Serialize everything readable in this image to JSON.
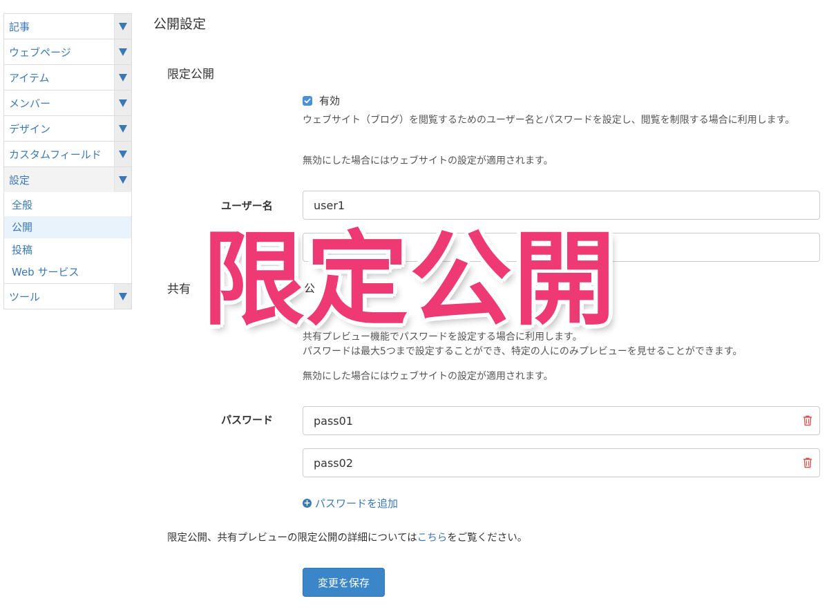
{
  "sidebar": {
    "items": [
      {
        "label": "記事"
      },
      {
        "label": "ウェブページ"
      },
      {
        "label": "アイテム"
      },
      {
        "label": "メンバー"
      },
      {
        "label": "デザイン"
      },
      {
        "label": "カスタムフィールド"
      },
      {
        "label": "設定"
      },
      {
        "label": "ツール"
      }
    ],
    "settings_submenu": [
      {
        "label": "全般"
      },
      {
        "label": "公開",
        "active": true
      },
      {
        "label": "投稿"
      },
      {
        "label": "Web サービス"
      }
    ]
  },
  "main": {
    "page_title": "公開設定",
    "limited": {
      "title": "限定公開",
      "checkbox_label": "有効",
      "checked": true,
      "help1": "ウェブサイト（ブログ）を閲覧するためのユーザー名とパスワードを設定し、閲覧を制限する場合に利用します。",
      "help2": "無効にした場合にはウェブサイトの設定が適用されます。",
      "username_label": "ユーザー名",
      "username_value": "user1"
    },
    "shared": {
      "title_partial": "共有",
      "checkbox_partial": "公",
      "help1": "共有プレビュー機能でパスワードを設定する場合に利用します。",
      "help2": "パスワードは最大5つまで設定することができ、特定の人にのみプレビューを見せることができます。",
      "help3": "無効にした場合にはウェブサイトの設定が適用されます。",
      "password_label": "パスワード",
      "passwords": [
        "pass01",
        "pass02"
      ],
      "add_password": "パスワードを追加"
    },
    "footer_note_before": "限定公開、共有プレビューの限定公開の詳細については",
    "footer_note_link": "こちら",
    "footer_note_after": "をご覧ください。",
    "save_button": "変更を保存"
  },
  "overlay": {
    "banner_text": "限定公開",
    "color": "#ee3a74"
  },
  "colors": {
    "link": "#3a78b5",
    "primary_button": "#3a86c8",
    "active_submenu_bg": "#e9f3fb"
  }
}
